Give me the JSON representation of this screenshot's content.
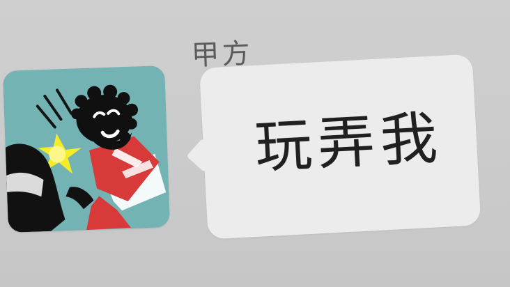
{
  "chat": {
    "sender_name": "甲方",
    "message_text": "玩弄我"
  },
  "colors": {
    "background": "#cccccc",
    "bubble": "#ececec",
    "avatar_background": "#74b3b4",
    "avatar_accent": "#d83a3a",
    "avatar_flash": "#f3ec27"
  },
  "avatar": {
    "icon": "avatar-image"
  }
}
